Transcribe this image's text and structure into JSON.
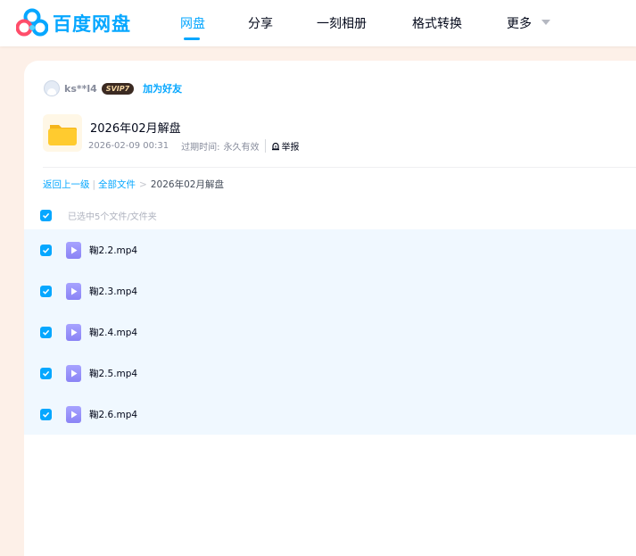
{
  "header": {
    "logo_text": "百度网盘",
    "nav": [
      {
        "label": "网盘",
        "active": true
      },
      {
        "label": "分享",
        "active": false
      },
      {
        "label": "一刻相册",
        "active": false
      },
      {
        "label": "格式转换",
        "active": false
      },
      {
        "label": "更多",
        "active": false
      }
    ],
    "more_icon": "chevron-down-icon"
  },
  "sharer": {
    "username": "ks**l4",
    "badge": "SVIP7",
    "add_friend_label": "加为好友"
  },
  "share": {
    "folder_name": "2026年02月解盘",
    "created": "2026-02-09 00:31",
    "expire_label": "过期时间:",
    "expire_value": "永久有效",
    "report_label": "举报",
    "folder_icon": "folder-icon"
  },
  "breadcrumb": {
    "back_label": "返回上一级",
    "separator": "|",
    "all_files_label": "全部文件",
    "arrow": ">",
    "current": "2026年02月解盘"
  },
  "selection": {
    "summary": "已选中5个文件/文件夹",
    "all_checked": true
  },
  "files": [
    {
      "name": "鞠2.2.mp4",
      "checked": true,
      "icon": "video-file-icon"
    },
    {
      "name": "鞠2.3.mp4",
      "checked": true,
      "icon": "video-file-icon"
    },
    {
      "name": "鞠2.4.mp4",
      "checked": true,
      "icon": "video-file-icon"
    },
    {
      "name": "鞠2.5.mp4",
      "checked": true,
      "icon": "video-file-icon"
    },
    {
      "name": "鞠2.6.mp4",
      "checked": true,
      "icon": "video-file-icon"
    }
  ],
  "colors": {
    "brand": "#06a7ff",
    "page_bg": "#fdf0e8",
    "selected_row_bg": "#f0f8ff",
    "video_icon": "#8a83f5"
  }
}
